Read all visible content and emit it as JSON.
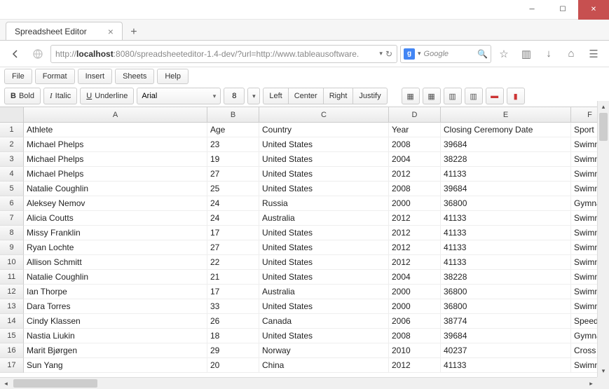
{
  "window": {
    "tab_title": "Spreadsheet Editor"
  },
  "url": {
    "prefix": "http://",
    "host": "localhost",
    "rest": ":8080/spreadsheeteditor-1.4-dev/?url=http://www.tableausoftware."
  },
  "search": {
    "engine": "Google",
    "g": "g"
  },
  "menus": [
    "File",
    "Format",
    "Insert",
    "Sheets",
    "Help"
  ],
  "format": {
    "bold": "Bold",
    "italic": "Italic",
    "underline": "Underline",
    "font": "Arial",
    "size": "8",
    "align": [
      "Left",
      "Center",
      "Right",
      "Justify"
    ]
  },
  "columns": [
    "",
    "A",
    "B",
    "C",
    "D",
    "E",
    "F"
  ],
  "chart_data": {
    "type": "table",
    "headers": [
      "Athlete",
      "Age",
      "Country",
      "Year",
      "Closing Ceremony Date",
      "Sport"
    ],
    "rows": [
      [
        "Michael Phelps",
        "23",
        "United States",
        "2008",
        "39684",
        "Swimming"
      ],
      [
        "Michael Phelps",
        "19",
        "United States",
        "2004",
        "38228",
        "Swimming"
      ],
      [
        "Michael Phelps",
        "27",
        "United States",
        "2012",
        "41133",
        "Swimming"
      ],
      [
        "Natalie Coughlin",
        "25",
        "United States",
        "2008",
        "39684",
        "Swimming"
      ],
      [
        "Aleksey Nemov",
        "24",
        "Russia",
        "2000",
        "36800",
        "Gymnastics"
      ],
      [
        "Alicia Coutts",
        "24",
        "Australia",
        "2012",
        "41133",
        "Swimming"
      ],
      [
        "Missy Franklin",
        "17",
        "United States",
        "2012",
        "41133",
        "Swimming"
      ],
      [
        "Ryan Lochte",
        "27",
        "United States",
        "2012",
        "41133",
        "Swimming"
      ],
      [
        "Allison Schmitt",
        "22",
        "United States",
        "2012",
        "41133",
        "Swimming"
      ],
      [
        "Natalie Coughlin",
        "21",
        "United States",
        "2004",
        "38228",
        "Swimming"
      ],
      [
        "Ian Thorpe",
        "17",
        "Australia",
        "2000",
        "36800",
        "Swimming"
      ],
      [
        "Dara Torres",
        "33",
        "United States",
        "2000",
        "36800",
        "Swimming"
      ],
      [
        "Cindy Klassen",
        "26",
        "Canada",
        "2006",
        "38774",
        "Speed Skating"
      ],
      [
        "Nastia Liukin",
        "18",
        "United States",
        "2008",
        "39684",
        "Gymnastics"
      ],
      [
        "Marit Bjørgen",
        "29",
        "Norway",
        "2010",
        "40237",
        "Cross Country"
      ],
      [
        "Sun Yang",
        "20",
        "China",
        "2012",
        "41133",
        "Swimming"
      ]
    ]
  }
}
